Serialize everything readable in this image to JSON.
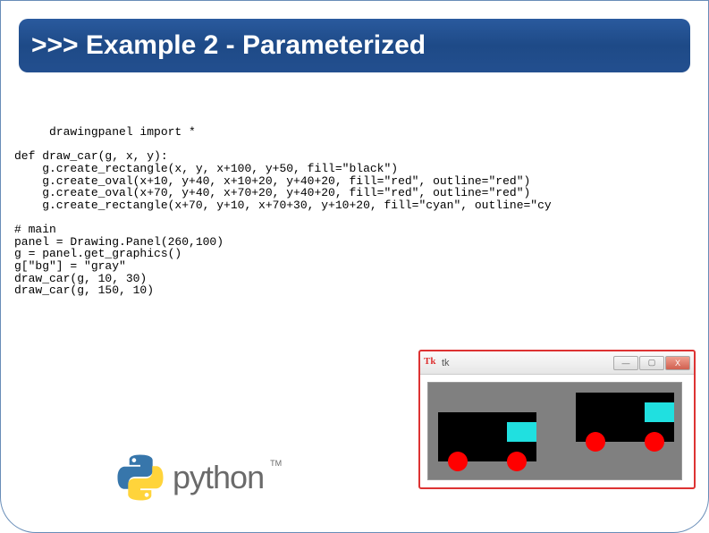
{
  "header": {
    "prompt": ">>>",
    "title": "Example 2 - Parameterized"
  },
  "code": {
    "line1": "     drawingpanel import *",
    "line2": "",
    "line3": "def draw_car(g, x, y):",
    "line4": "    g.create_rectangle(x, y, x+100, y+50, fill=\"black\")",
    "line5": "    g.create_oval(x+10, y+40, x+10+20, y+40+20, fill=\"red\", outline=\"red\")",
    "line6": "    g.create_oval(x+70, y+40, x+70+20, y+40+20, fill=\"red\", outline=\"red\")",
    "line7": "    g.create_rectangle(x+70, y+10, x+70+30, y+10+20, fill=\"cyan\", outline=\"cy",
    "line8": "",
    "line9": "# main",
    "line10": "panel = Drawing.Panel(260,100)",
    "line11": "g = panel.get_graphics()",
    "line12": "g[\"bg\"] = \"gray\"",
    "line13": "draw_car(g, 10, 30)",
    "line14": "draw_car(g, 150, 10)"
  },
  "logo": {
    "text": "python",
    "tm": "TM"
  },
  "tkwindow": {
    "icon": "Tk",
    "title": "tk",
    "min": "—",
    "max": "▢",
    "close": "X"
  }
}
